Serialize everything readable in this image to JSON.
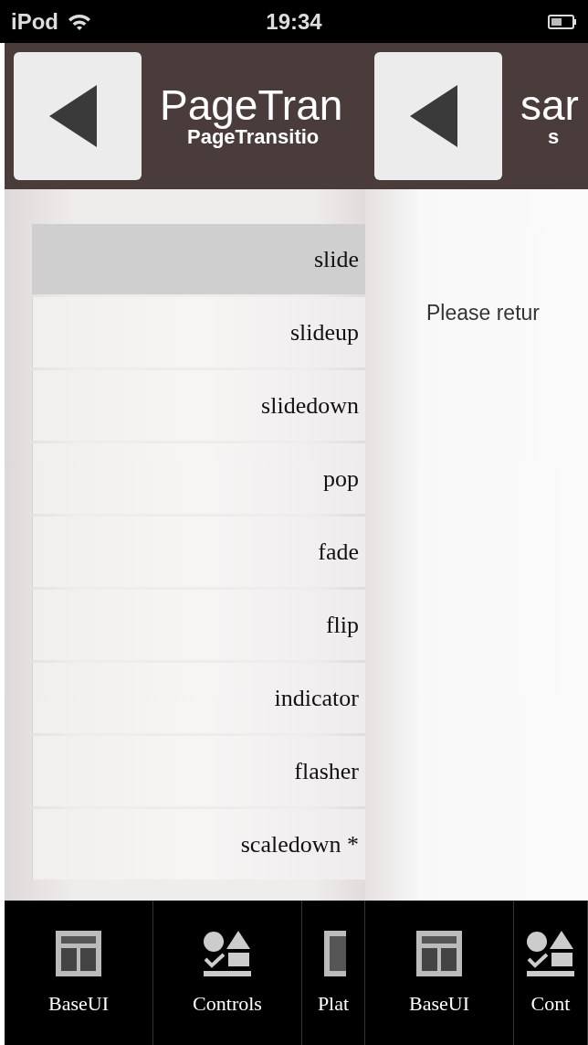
{
  "status_bar": {
    "carrier": "iPod",
    "time": "19:34"
  },
  "pages": [
    {
      "header": {
        "title": "PageTran",
        "subtitle": "PageTransitio"
      },
      "list": [
        {
          "label": "slide",
          "selected": true
        },
        {
          "label": "slideup",
          "selected": false
        },
        {
          "label": "slidedown",
          "selected": false
        },
        {
          "label": "pop",
          "selected": false
        },
        {
          "label": "fade",
          "selected": false
        },
        {
          "label": "flip",
          "selected": false
        },
        {
          "label": "indicator",
          "selected": false
        },
        {
          "label": "flasher",
          "selected": false
        },
        {
          "label": "scaledown *",
          "selected": false
        }
      ],
      "tab_bar": [
        {
          "label": "BaseUI",
          "kind": "layout"
        },
        {
          "label": "Controls",
          "kind": "shapes"
        },
        {
          "label": "Plat",
          "kind": "panel"
        }
      ]
    },
    {
      "header": {
        "title": "sar",
        "subtitle": "s"
      },
      "message": "Please retur",
      "tab_bar": [
        {
          "label": "BaseUI",
          "kind": "layout"
        },
        {
          "label": "Cont",
          "kind": "shapes"
        }
      ]
    }
  ]
}
